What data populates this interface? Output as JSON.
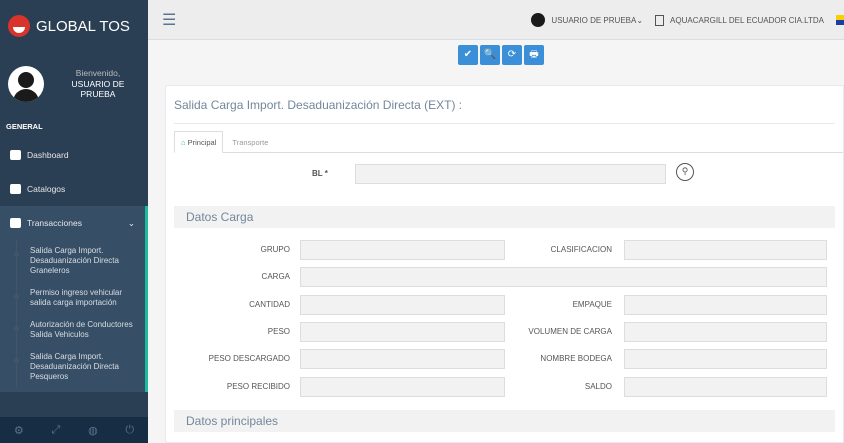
{
  "brand": "GLOBAL TOS",
  "profile": {
    "welcome": "Bienvenido,",
    "user": "USUARIO DE PRUEBA"
  },
  "sidebar": {
    "section": "GENERAL",
    "items": [
      {
        "label": "Dashboard",
        "icon": "dashboard-icon"
      },
      {
        "label": "Catalogos",
        "icon": "book-icon"
      },
      {
        "label": "Transacciones",
        "icon": "gears-icon"
      }
    ],
    "submenu": [
      "Salida Carga Import. Desaduanización Directa Graneleros",
      "Permiso ingreso vehicular salida carga importación",
      "Autorización de Conductores Salida Vehiculos",
      "Salida Carga Import. Desaduanización Directa Pesqueros"
    ],
    "footer_icons": [
      "settings-icon",
      "fullscreen-icon",
      "lock-icon",
      "power-icon"
    ]
  },
  "topbar": {
    "user": "USUARIO DE PRUEBA",
    "company": "AQUACARGILL DEL ECUADOR CIA.LTDA"
  },
  "toolbar": {
    "accept": "✔",
    "search": "🔍",
    "refresh": "⟳",
    "print": "🖶"
  },
  "page": {
    "title": "Salida Carga Import. Desaduanización Directa (EXT) :",
    "tabs": [
      "Principal",
      "Transporte"
    ]
  },
  "form": {
    "bl_label": "BL *",
    "section1": "Datos Carga",
    "section2": "Datos principales",
    "left_labels": [
      "GRUPO",
      "CARGA",
      "CANTIDAD",
      "PESO",
      "PESO DESCARGADO",
      "PESO RECIBIDO"
    ],
    "right_labels": [
      "CLASIFICACION",
      "EMPAQUE",
      "VOLUMEN DE CARGA",
      "NOMBRE BODEGA",
      "SALDO"
    ]
  },
  "colors": {
    "sidebar": "#2a3f54",
    "accent": "#1abb9c",
    "button": "#3a8fd8"
  }
}
